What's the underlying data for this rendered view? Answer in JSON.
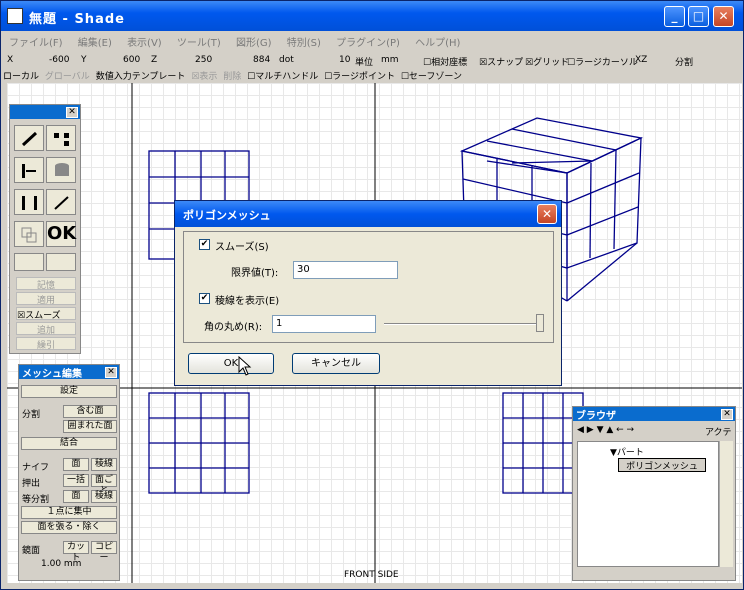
{
  "window": {
    "title": "無題 - Shade"
  },
  "menu": [
    "ファイル(F)",
    "編集(E)",
    "表示(V)",
    "ツール(T)",
    "図形(G)",
    "特別(S)",
    "プラグイン(P)",
    "ヘルプ(H)"
  ],
  "coords": {
    "x_label": "X",
    "x_value": "-600",
    "y_label": "Y",
    "y_value": "600",
    "z_label": "Z",
    "z_value": "250",
    "w_value": "884",
    "unit_suffix": "dot",
    "grid_value": "10",
    "unit_label": "単位",
    "unit_value": "mm",
    "relative": "相対座標",
    "snap": "スナップ",
    "grid": "グリッド",
    "large_cursor": "ラージカーソル",
    "plane": "XZ",
    "split": "分割"
  },
  "options": [
    "ローカル",
    "グローバル",
    "数値入力テンプレート",
    "☒表示",
    "削除",
    "☐マルチハンドル",
    "☐ラージポイント",
    "☐セーフゾーン"
  ],
  "views": {
    "front": "FRONT SIDE"
  },
  "tool_palette": {
    "ok": "OK",
    "buttons": [
      "記憶",
      "適用",
      "☒スムーズ",
      "追加",
      "繰引"
    ]
  },
  "mesh_palette": {
    "title": "メッシュ編集",
    "settings": "設定",
    "split": "分割",
    "include_face": "含む面",
    "enclosed_face": "囲まれた面",
    "join": "結合",
    "knife": "ナイフ",
    "face": "面",
    "edge": "稜線",
    "extrude": "押出",
    "all": "一括",
    "per_face": "面ごと",
    "equal_split": "等分割",
    "one_point": "１点に集中",
    "stretch_face": "面を張る・除く",
    "mirror": "鏡面",
    "cut": "カット",
    "copy": "コピー",
    "value": "1.00 mm"
  },
  "dialog": {
    "title": "ポリゴンメッシュ",
    "smooth": "スムーズ(S)",
    "threshold_label": "限界値(T):",
    "threshold": "30",
    "show_edges": "稜線を表示(E)",
    "round_label": "角の丸め(R):",
    "round": "1",
    "ok": "OK",
    "cancel": "キャンセル"
  },
  "browser": {
    "title": "ブラウザ",
    "tab": "アクティ",
    "part": "▼パート",
    "item": "ポリゴンメッシュ"
  }
}
